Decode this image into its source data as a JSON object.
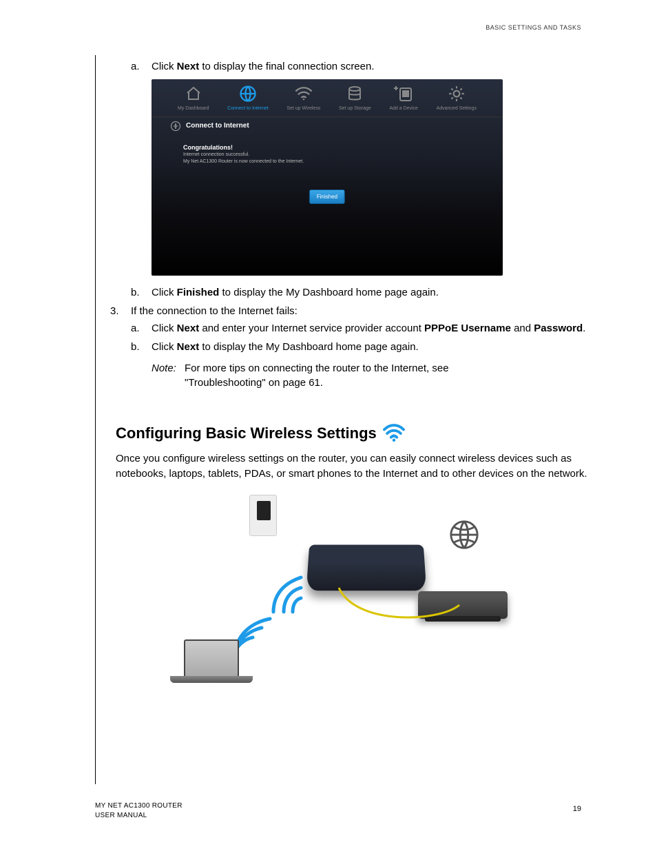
{
  "header": {
    "title": "BASIC SETTINGS AND TASKS"
  },
  "steps": {
    "step_a1_prefix": "a.",
    "step_a1_text1": "Click ",
    "step_a1_bold1": "Next",
    "step_a1_text2": " to display the final connection screen.",
    "step_b1_prefix": "b.",
    "step_b1_text1": "Click ",
    "step_b1_bold1": "Finished",
    "step_b1_text2": " to display the My Dashboard home page again.",
    "step3_prefix": "3.",
    "step3_text": "If the connection to the Internet fails:",
    "step3a_prefix": "a.",
    "step3a_t1": "Click ",
    "step3a_b1": "Next",
    "step3a_t2": " and enter your Internet service provider account ",
    "step3a_b2": "PPPoE Username",
    "step3a_t3": " and ",
    "step3a_b3": "Password",
    "step3a_t4": ".",
    "step3b_prefix": "b.",
    "step3b_t1": "Click ",
    "step3b_b1": "Next",
    "step3b_t2": " to display the My Dashboard home page again.",
    "note_label": "Note:",
    "note_text": "For more tips on connecting the router to the Internet, see \"Troubleshooting\" on page 61."
  },
  "router_ui": {
    "nav": {
      "dashboard": "My Dashboard",
      "connect": "Connect to Internet",
      "wireless": "Set up Wireless",
      "storage": "Set up Storage",
      "add_device": "Add a Device",
      "advanced": "Advanced Settings"
    },
    "section_title": "Connect to Internet",
    "congrats_title": "Congratulations!",
    "congrats_l1": "Internet connection successful.",
    "congrats_l2": "My Net AC1300 Router is now connected to the Internet.",
    "finished_btn": "Finished"
  },
  "section": {
    "heading": "Configuring Basic Wireless Settings",
    "para": "Once you configure wireless settings on the router, you can easily connect wireless devices such as notebooks, laptops, tablets, PDAs, or smart phones to the Internet and to other devices on the network."
  },
  "footer": {
    "line1": "MY NET AC1300 ROUTER",
    "line2": "USER MANUAL",
    "page": "19"
  }
}
